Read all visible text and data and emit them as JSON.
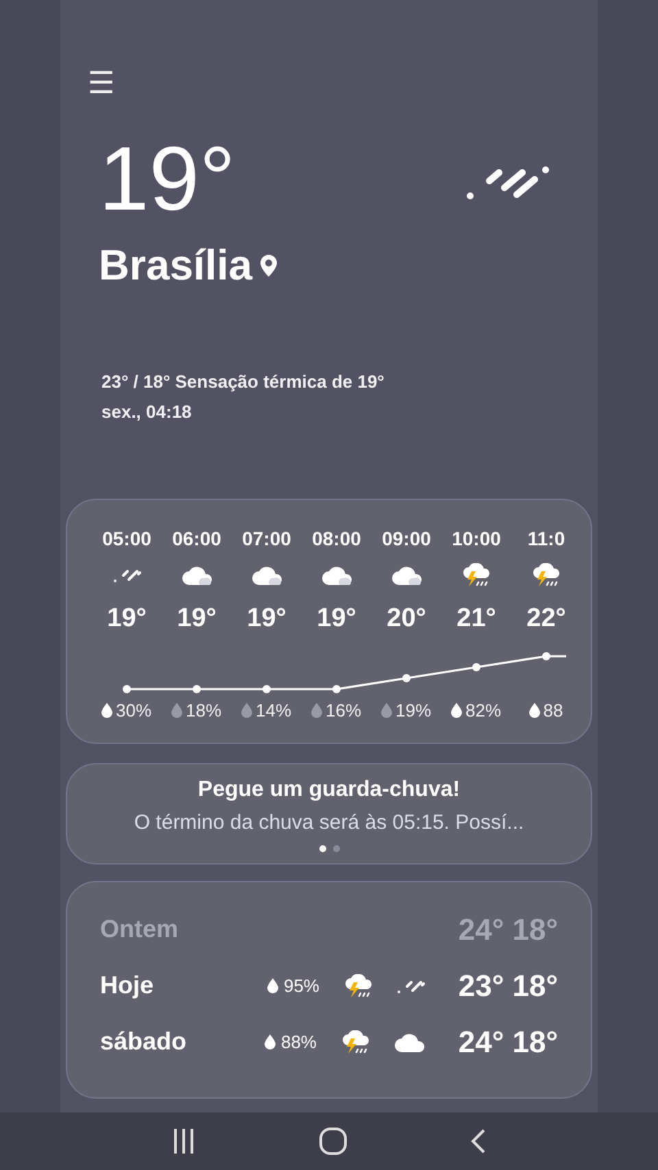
{
  "menu_icon": "☰",
  "current": {
    "temperature": "19°",
    "city": "Brasília",
    "kind": "rain",
    "summary": "23° / 18° Sensação térmica de 19°",
    "time": "sex., 04:18"
  },
  "hourly": [
    {
      "time": "05:00",
      "kind": "rain",
      "temp": "19°",
      "precip": "30%",
      "strong": true
    },
    {
      "time": "06:00",
      "kind": "cloud",
      "temp": "19°",
      "precip": "18%",
      "strong": false
    },
    {
      "time": "07:00",
      "kind": "cloud",
      "temp": "19°",
      "precip": "14%",
      "strong": false
    },
    {
      "time": "08:00",
      "kind": "cloud",
      "temp": "19°",
      "precip": "16%",
      "strong": false
    },
    {
      "time": "09:00",
      "kind": "cloud",
      "temp": "20°",
      "precip": "19%",
      "strong": false
    },
    {
      "time": "10:00",
      "kind": "storm",
      "temp": "21°",
      "precip": "82%",
      "strong": true
    },
    {
      "time": "11:0",
      "kind": "storm",
      "temp": "22°",
      "precip": "88",
      "strong": true
    }
  ],
  "alert": {
    "title": "Pegue um guarda-chuva!",
    "text": "O término da chuva será às 05:15. Possí...",
    "pages": [
      {
        "selected": true
      },
      {
        "selected": false
      }
    ]
  },
  "daily": [
    {
      "day": "Ontem",
      "muted": true,
      "high": "24°",
      "low": "18°"
    },
    {
      "day": "Hoje",
      "muted": false,
      "precip": "95%",
      "icons": [
        {
          "kind": "storm"
        },
        {
          "kind": "rain"
        }
      ],
      "high": "23°",
      "low": "18°"
    },
    {
      "day": "sábado",
      "muted": false,
      "precip": "88%",
      "icons": [
        {
          "kind": "storm"
        },
        {
          "kind": "cloud"
        }
      ],
      "high": "24°",
      "low": "18°"
    }
  ]
}
